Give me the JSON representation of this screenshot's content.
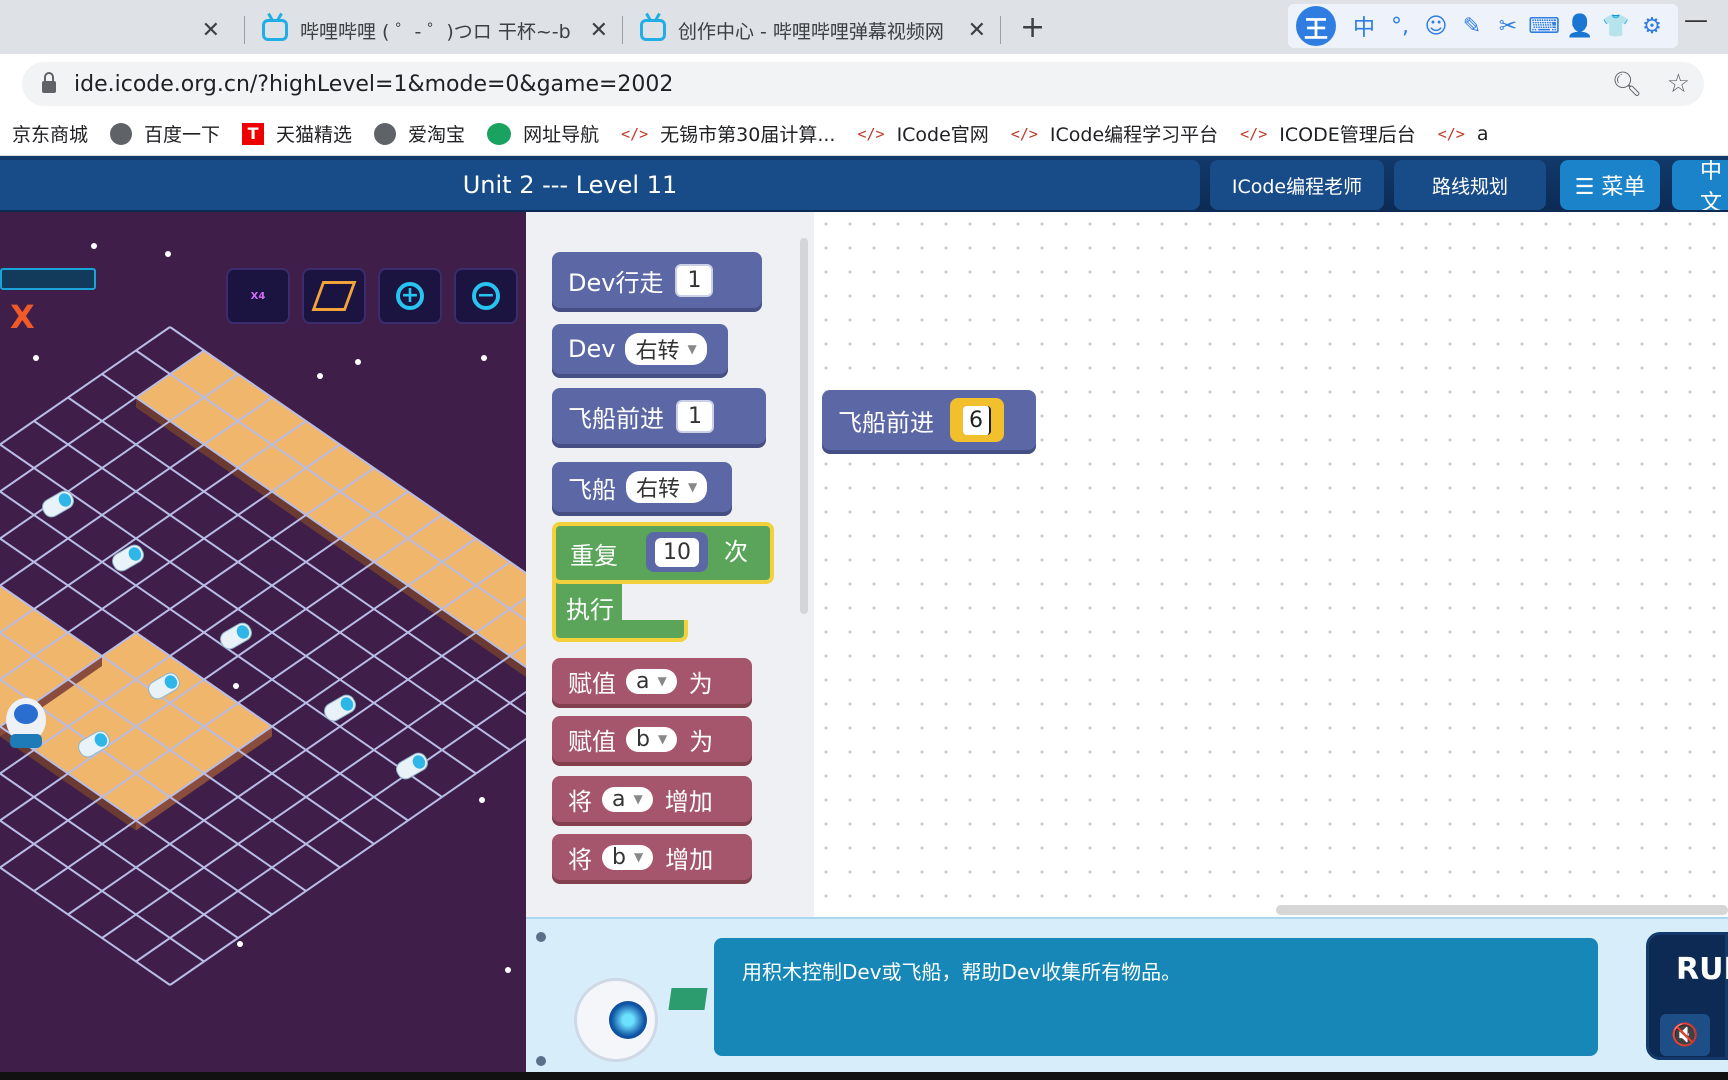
{
  "browser": {
    "tabs": [
      {
        "title": "",
        "close": "✕",
        "active": false
      },
      {
        "title": "哔哩哔哩 ( ゜- ゜)つロ 干杯~-bilib",
        "close": "✕",
        "active": true
      },
      {
        "title": "创作中心 - 哔哩哔哩弹幕视频网",
        "close": "✕",
        "active": false
      }
    ],
    "new_tab": "+",
    "ime": {
      "logo": "王",
      "icons": [
        "中",
        "°,",
        "☺",
        "✎",
        "✂",
        "⌨",
        "👤",
        "👕",
        "⚙"
      ]
    },
    "minimize": "—",
    "url": "ide.icode.org.cn/?highLevel=1&mode=0&game=2002",
    "bookmarks": [
      {
        "label": "京东商城",
        "icon": "none"
      },
      {
        "label": "百度一下",
        "icon": "globe-icon"
      },
      {
        "label": "天猫精选",
        "icon": "tmall-icon"
      },
      {
        "label": "爱淘宝",
        "icon": "globe-icon"
      },
      {
        "label": "网址导航",
        "icon": "nav-icon"
      },
      {
        "label": "无锡市第30届计算...",
        "icon": "code-icon"
      },
      {
        "label": "ICode官网",
        "icon": "code-icon"
      },
      {
        "label": "ICode编程学习平台",
        "icon": "code-icon"
      },
      {
        "label": "ICODE管理后台",
        "icon": "code-icon"
      },
      {
        "label": "a",
        "icon": "code-icon"
      }
    ]
  },
  "game": {
    "level_title": "Unit 2 --- Level 11",
    "buttons": {
      "teacher": "ICode编程老师",
      "route": "路线规划",
      "menu": "☰ 菜单",
      "lang": "中文"
    },
    "stage": {
      "x_mark": "X",
      "speed_label": "X4"
    },
    "toolbox": {
      "dev_walk": {
        "label": "Dev行走",
        "value": "1"
      },
      "dev_turn": {
        "label": "Dev",
        "option": "右转"
      },
      "ship_forward": {
        "label": "飞船前进",
        "value": "1"
      },
      "ship_turn": {
        "label": "飞船",
        "option": "右转"
      },
      "repeat": {
        "label": "重复",
        "count": "10",
        "suffix": "次",
        "exec": "执行"
      },
      "assign_a": {
        "label": "赋值",
        "var": "a",
        "suffix": "为"
      },
      "assign_b": {
        "label": "赋值",
        "var": "b",
        "suffix": "为"
      },
      "inc_a": {
        "label": "将",
        "var": "a",
        "suffix": "增加"
      },
      "inc_b": {
        "label": "将",
        "var": "b",
        "suffix": "增加"
      }
    },
    "workspace": {
      "block_label": "飞船前进",
      "block_value": "6"
    },
    "hint": "用积木控制Dev或飞船，帮助Dev收集所有物品。",
    "run_label": "RUN",
    "mute_icon": "🔇"
  },
  "colors": {
    "stage_bg": "#3f1f4a",
    "tile": "#f0b66b",
    "grid": "#b9bde6",
    "accent": "#1687b6"
  }
}
